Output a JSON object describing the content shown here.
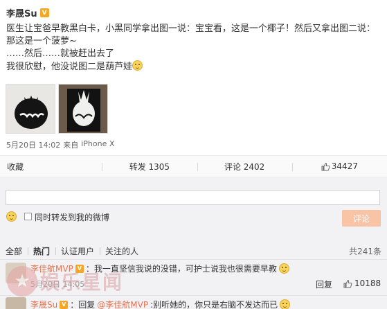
{
  "post": {
    "author": "李晟Su",
    "badge": "V",
    "lines": [
      "医生让宝爸早教黑白卡，小黑同学拿出图一说：宝宝看，这是一个椰子！然后又拿出图二说：",
      "那这是一个菠萝~",
      "……然后……就被赶出去了",
      "我很欣慰，他没说图二是葫芦娃"
    ],
    "time": "5月20日 14:02",
    "source_prefix": "来自",
    "source": "iPhone X"
  },
  "actions": {
    "collect": "收藏",
    "repost": "转发 1305",
    "comment": "评论 2402",
    "like": "34427"
  },
  "composer": {
    "repost_label": "同时转发到我的微博",
    "submit": "评论"
  },
  "filters": [
    "全部",
    "热门",
    "认证用户",
    "关注的人"
  ],
  "total": "共241条",
  "comments": [
    {
      "user": "李佳航MVP",
      "badge": "V",
      "text": "：我一直坚信我说的没错，可护士说我也很需要早教",
      "time": "5月20日 14:05",
      "reply": "回复",
      "likes": "10188"
    },
    {
      "user": "李晟Su",
      "badge": "V",
      "text_prefix": "：回复",
      "mention": "@李佳航MVP",
      "text": ":别听她的，你只是右脑不发达而已"
    }
  ],
  "watermark": "娱乐星闻",
  "colors": {
    "accent": "#eb7350",
    "badge": "#f5a623",
    "submit": "#f9c3a6"
  }
}
